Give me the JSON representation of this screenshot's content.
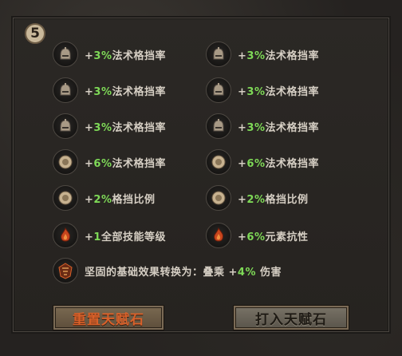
{
  "rank": "5",
  "left_rows": [
    {
      "prefix": "+",
      "num": "3%",
      "suffix": "法术格挡率",
      "icon": "helmet-icon"
    },
    {
      "prefix": "+",
      "num": "3%",
      "suffix": "法术格挡率",
      "icon": "helmet-icon"
    },
    {
      "prefix": "+",
      "num": "3%",
      "suffix": "法术格挡率",
      "icon": "helmet-icon"
    },
    {
      "prefix": "+",
      "num": "6%",
      "suffix": "法术格挡率",
      "icon": "shield-orb-icon"
    },
    {
      "prefix": "+",
      "num": "2%",
      "suffix": "格挡比例",
      "icon": "shield-orb-icon"
    },
    {
      "prefix": "+",
      "num": "1",
      "suffix": "全部技能等级",
      "icon": "flame-orb-icon"
    }
  ],
  "right_rows": [
    {
      "prefix": "+",
      "num": "3%",
      "suffix": "法术格挡率",
      "icon": "helmet-icon"
    },
    {
      "prefix": "+",
      "num": "3%",
      "suffix": "法术格挡率",
      "icon": "helmet-icon"
    },
    {
      "prefix": "+",
      "num": "3%",
      "suffix": "法术格挡率",
      "icon": "helmet-icon"
    },
    {
      "prefix": "+",
      "num": "6%",
      "suffix": "法术格挡率",
      "icon": "shield-orb-icon"
    },
    {
      "prefix": "+",
      "num": "2%",
      "suffix": "格挡比例",
      "icon": "shield-orb-icon"
    },
    {
      "prefix": "+",
      "num": "6%",
      "suffix": "元素抗性",
      "icon": "flame-orb-icon"
    }
  ],
  "special": {
    "prefix": "坚固的基础效果转换为：叠乘 +",
    "num": "4%",
    "suffix": " 伤害",
    "icon": "rune-emblem-icon"
  },
  "buttons": {
    "reset": "重置天赋石",
    "insert": "打入天赋石"
  },
  "colors": {
    "bonus_value": "#7ed957",
    "text": "#d6cfc4",
    "reset_label": "#d9612a"
  }
}
